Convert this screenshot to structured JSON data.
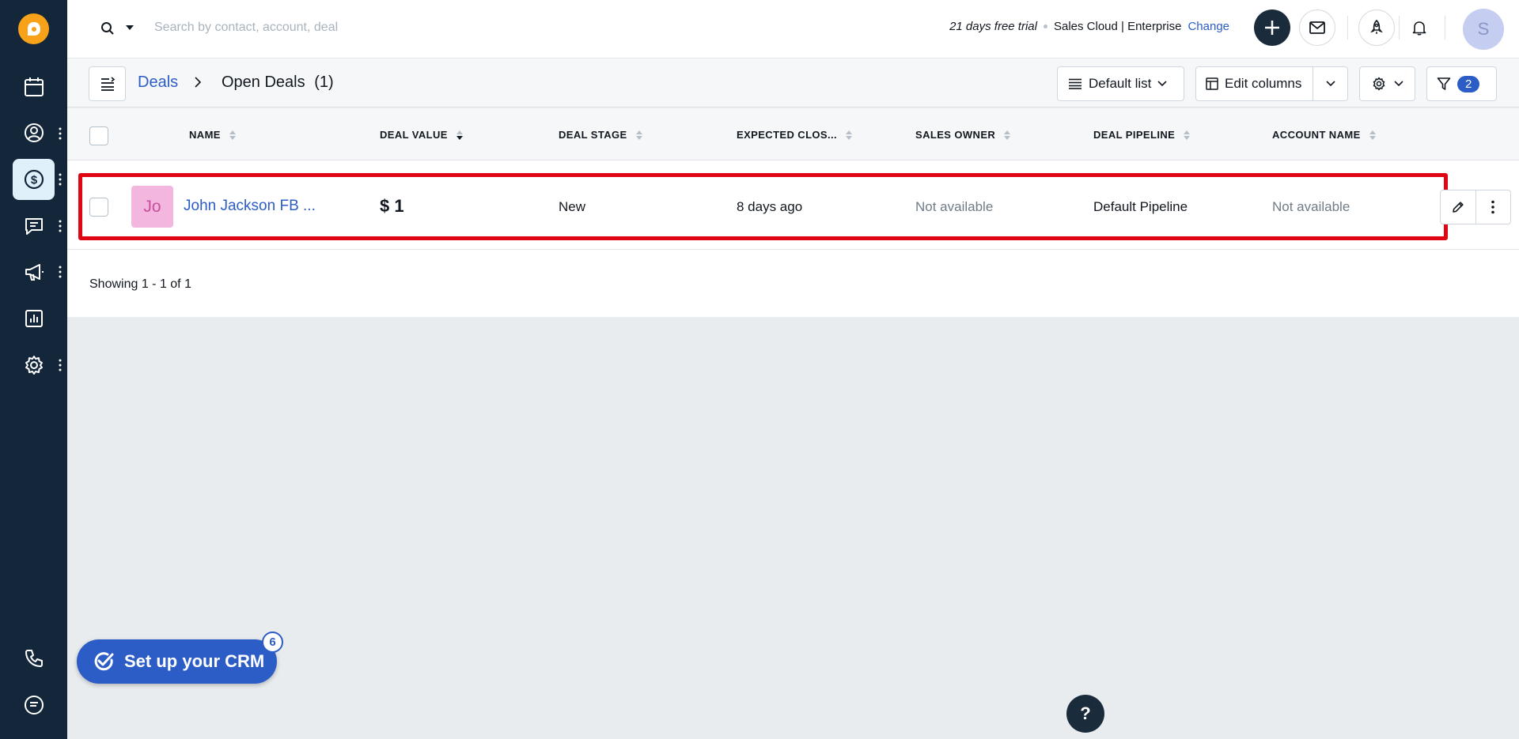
{
  "topbar": {
    "search_placeholder": "Search by contact, account, deal",
    "trial_text": "21 days free trial",
    "plan": "Sales Cloud | Enterprise",
    "change_link": "Change",
    "avatar_initial": "S"
  },
  "sidebar": {
    "items": [
      {
        "icon": "calendar-icon"
      },
      {
        "icon": "contact-icon"
      },
      {
        "icon": "deals-icon",
        "active": true
      },
      {
        "icon": "chat-icon"
      },
      {
        "icon": "megaphone-icon"
      },
      {
        "icon": "reports-icon"
      },
      {
        "icon": "settings-icon"
      },
      {
        "icon": "phone-icon"
      },
      {
        "icon": "notes-icon"
      }
    ]
  },
  "header": {
    "breadcrumb_root": "Deals",
    "breadcrumb_current": "Open Deals",
    "breadcrumb_count": "(1)",
    "view_label": "Default list",
    "edit_columns_label": "Edit columns",
    "filter_count": "2"
  },
  "table": {
    "columns": [
      "NAME",
      "DEAL VALUE",
      "DEAL STAGE",
      "EXPECTED CLOS...",
      "SALES OWNER",
      "DEAL PIPELINE",
      "ACCOUNT NAME"
    ],
    "rows": [
      {
        "avatar": "Jo",
        "name": "John Jackson FB ...",
        "deal_value": "$ 1",
        "deal_stage": "New",
        "expected_close": "8 days ago",
        "sales_owner": "Not available",
        "deal_pipeline": "Default Pipeline",
        "account_name": "Not available"
      }
    ],
    "showing": "Showing 1 - 1 of 1"
  },
  "floating": {
    "setup_label": "Set up your CRM",
    "setup_badge": "6",
    "help_label": "?"
  },
  "colors": {
    "sidebar_bg": "#13263a",
    "accent": "#2c5cc5",
    "highlight": "#e00512",
    "logo": "#f8a21a"
  }
}
